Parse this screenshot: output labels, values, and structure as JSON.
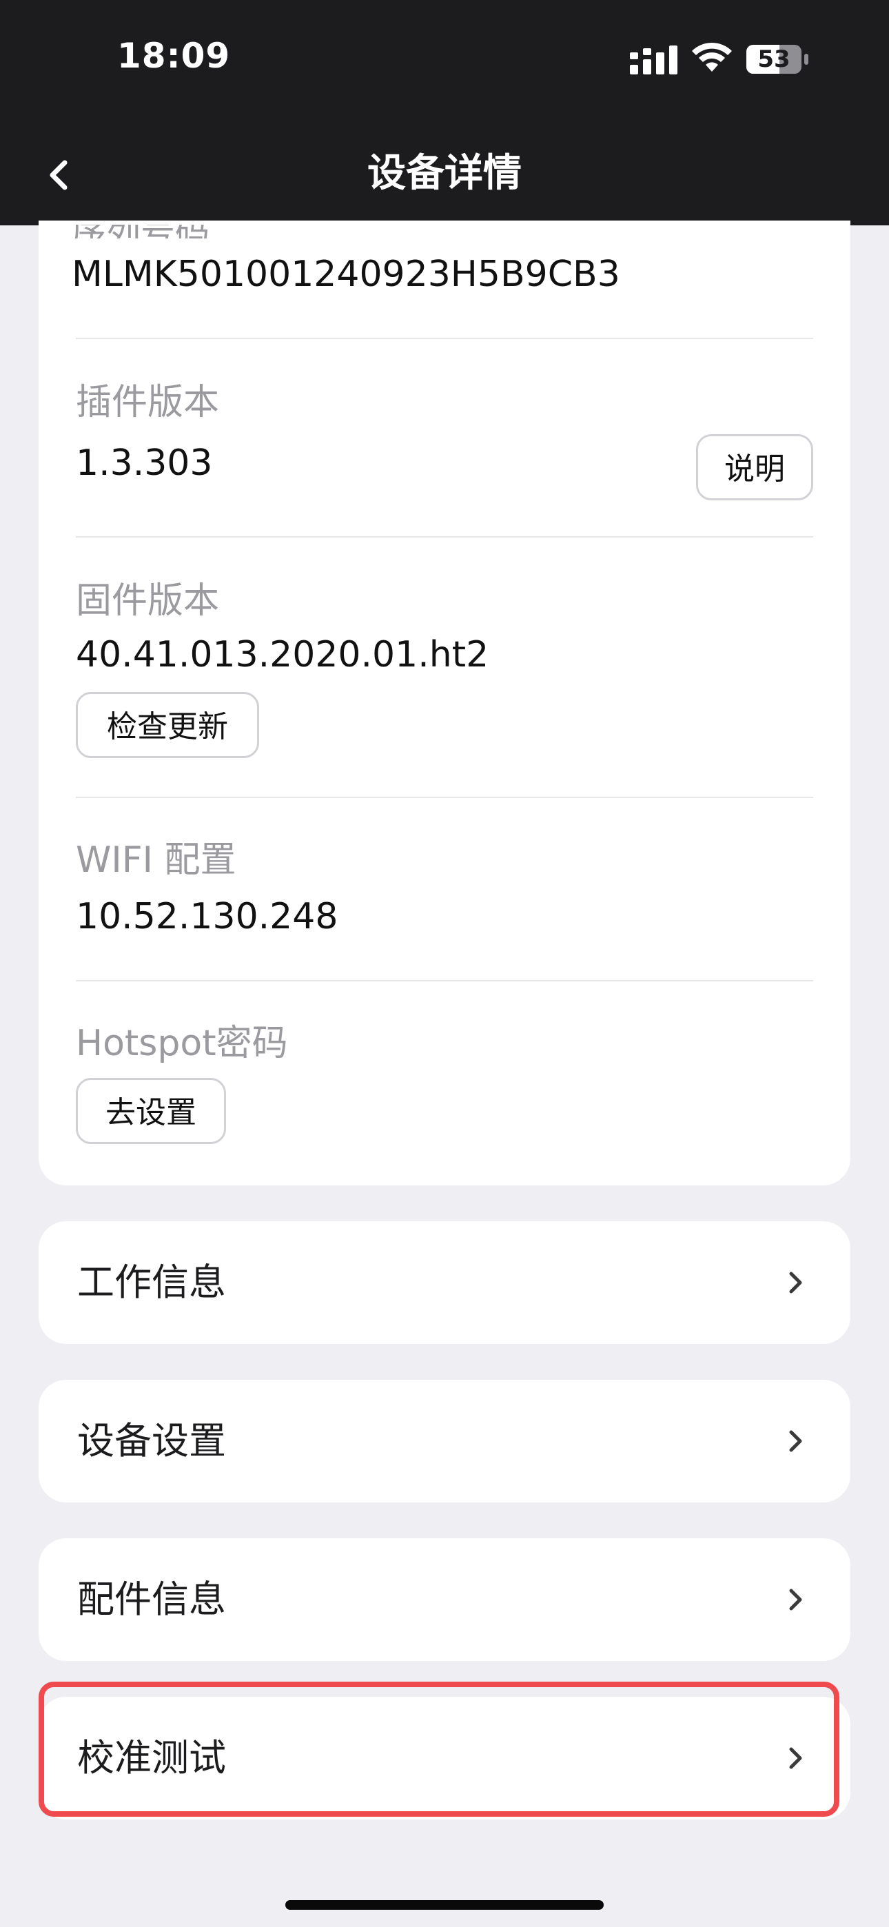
{
  "status": {
    "time": "18:09",
    "battery": "53"
  },
  "header": {
    "title": "设备详情"
  },
  "details": {
    "serial_label_partial": "序列号码",
    "serial_value": "MLMK501001240923H5B9CB3",
    "plugin_label": "插件版本",
    "plugin_value": "1.3.303",
    "plugin_button": "说明",
    "firmware_label": "固件版本",
    "firmware_value": "40.41.013.2020.01.ht2",
    "firmware_button": "检查更新",
    "wifi_label": "WIFI 配置",
    "wifi_value": "10.52.130.248",
    "hotspot_label": "Hotspot密码",
    "hotspot_button": "去设置"
  },
  "menu": [
    {
      "label": "工作信息"
    },
    {
      "label": "设备设置"
    },
    {
      "label": "配件信息"
    },
    {
      "label": "校准测试"
    }
  ],
  "colors": {
    "header_bg": "#1c1c1e",
    "page_bg": "#efeff3",
    "highlight": "#ef4b4f"
  }
}
